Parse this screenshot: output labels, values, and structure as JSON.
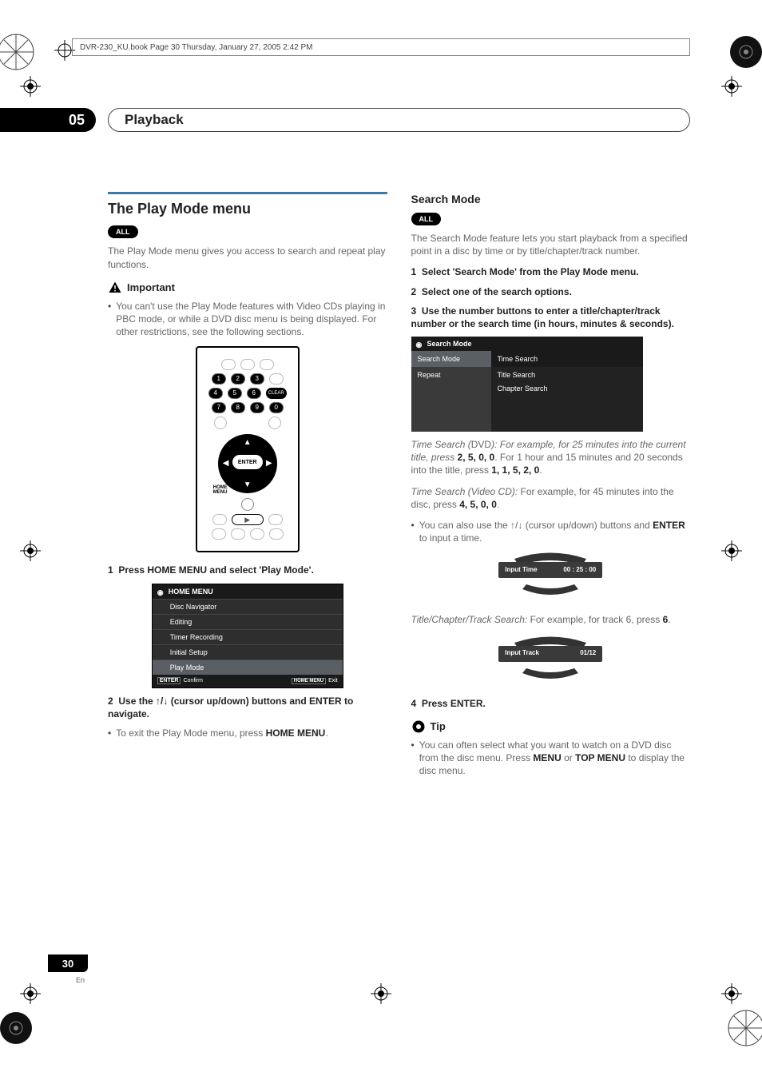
{
  "book_header": "DVR-230_KU.book  Page 30  Thursday, January 27, 2005  2:42 PM",
  "chapter": {
    "num": "05",
    "title": "Playback"
  },
  "page_number": "30",
  "page_lang": "En",
  "left": {
    "h2": "The Play Mode menu",
    "pill": "ALL",
    "intro": "The Play Mode menu gives you access to search and repeat play functions.",
    "important_label": "Important",
    "important_body": "You can't use the Play Mode features with Video CDs playing in PBC mode, or while a DVD disc menu is being displayed. For other restrictions, see the following sections.",
    "remote": {
      "nums": [
        "1",
        "2",
        "3",
        "4",
        "5",
        "6",
        "7",
        "8",
        "9",
        "0"
      ],
      "clear": "CLEAR",
      "enter": "ENTER",
      "home_menu": "HOME\nMENU"
    },
    "step1": {
      "n": "1",
      "t": "Press HOME MENU and select 'Play Mode'."
    },
    "menu": {
      "title": "HOME MENU",
      "items": [
        "Disc Navigator",
        "Editing",
        "Timer Recording",
        "Initial Setup",
        "Play Mode"
      ],
      "footer_left_key": "ENTER",
      "footer_left": "Confirm",
      "footer_right_key": "HOME MENU",
      "footer_right": "Exit"
    },
    "step2": {
      "n": "2",
      "t1": "Use the ",
      "t2": " (cursor up/down) buttons and ENTER to navigate."
    },
    "step2_bullet": "To exit the Play Mode menu, press ",
    "step2_bullet_b": "HOME MENU",
    "step2_bullet_end": "."
  },
  "right": {
    "h3": "Search Mode",
    "pill": "ALL",
    "intro": "The Search Mode feature lets you start playback from a specified point in a disc by time or by title/chapter/track number.",
    "step1": {
      "n": "1",
      "t": "Select 'Search Mode' from the Play Mode menu."
    },
    "step2": {
      "n": "2",
      "t": "Select one of the search options."
    },
    "step3": {
      "n": "3",
      "t": "Use the number buttons to enter a title/chapter/track number or the search time (in hours, minutes & seconds)."
    },
    "searchshot": {
      "title": "Search Mode",
      "left": [
        "Search Mode",
        "Repeat"
      ],
      "right": [
        "Time Search",
        "Title Search",
        "Chapter Search"
      ]
    },
    "ts_dvd_label": "Time Search (",
    "ts_dvd_dvd": "DVD",
    "ts_dvd_rest": "): For example, for 25 minutes into the current title, press ",
    "ts_dvd_b1": "2, 5, 0, 0",
    "ts_dvd_mid": ". For 1 hour and 15 minutes and 20 seconds into the title, press ",
    "ts_dvd_b2": "1, 1, 5, 2, 0",
    "ts_dvd_end": ".",
    "ts_vcd_label": "Time Search (Video CD):",
    "ts_vcd_rest": " For example, for 45 minutes into the disc, press ",
    "ts_vcd_b": "4, 5, 0, 0",
    "ts_vcd_end": ".",
    "ts_bullet_a": "You can also use the ",
    "ts_bullet_b": " (cursor up/down) buttons and ",
    "ts_bullet_c": "ENTER",
    "ts_bullet_d": " to input a time.",
    "osd1": {
      "label": "Input Time",
      "value": "00 : 25 : 00"
    },
    "tct_label": "Title/Chapter/Track Search:",
    "tct_rest": " For example, for track 6, press ",
    "tct_b": "6",
    "tct_end": ".",
    "osd2": {
      "label": "Input Track",
      "value": "01/12"
    },
    "step4": {
      "n": "4",
      "t": "Press ENTER."
    },
    "tip_label": "Tip",
    "tip_a": "You can often select what you want to watch on a DVD disc from the disc menu. Press ",
    "tip_b1": "MENU",
    "tip_mid": " or ",
    "tip_b2": "TOP MENU",
    "tip_end": " to display the disc menu."
  }
}
